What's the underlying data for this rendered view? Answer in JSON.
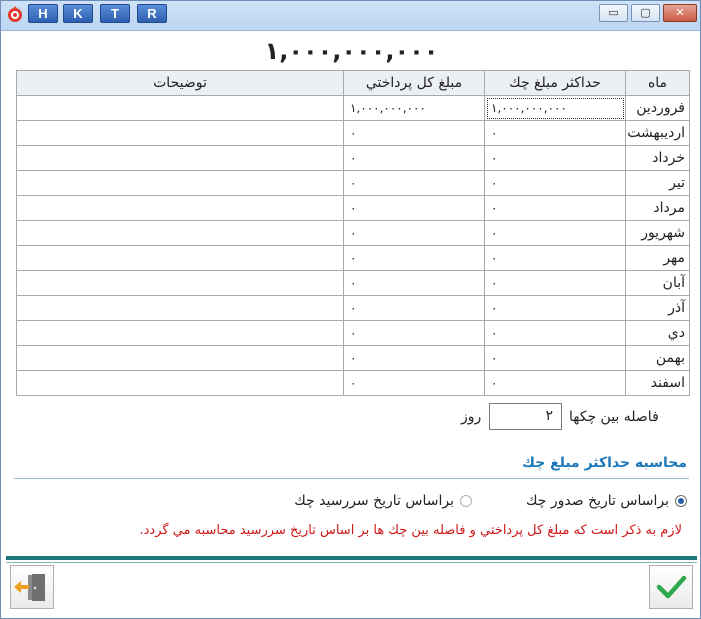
{
  "titlebar": {
    "hotkeys": [
      "H",
      "K",
      "T",
      "R"
    ],
    "minimize_label": "▭",
    "maximize_label": "▢",
    "close_label": "✕"
  },
  "total_amount": "۱,۰۰۰,۰۰۰,۰۰۰",
  "table": {
    "headers": {
      "month": "ماه",
      "max_check": "حداکثر مبلغ چك",
      "total_payment": "مبلغ کل پرداختي",
      "notes": "توضيحات"
    },
    "rows": [
      {
        "month": "فروردين",
        "max_check": "۱,۰۰۰,۰۰۰,۰۰۰",
        "total_payment": "۱,۰۰۰,۰۰۰,۰۰۰",
        "notes": ""
      },
      {
        "month": "ارديبهشت",
        "max_check": "۰",
        "total_payment": "۰",
        "notes": ""
      },
      {
        "month": "خرداد",
        "max_check": "۰",
        "total_payment": "۰",
        "notes": ""
      },
      {
        "month": "تير",
        "max_check": "۰",
        "total_payment": "۰",
        "notes": ""
      },
      {
        "month": "مرداد",
        "max_check": "۰",
        "total_payment": "۰",
        "notes": ""
      },
      {
        "month": "شهريور",
        "max_check": "۰",
        "total_payment": "۰",
        "notes": ""
      },
      {
        "month": "مهر",
        "max_check": "۰",
        "total_payment": "۰",
        "notes": ""
      },
      {
        "month": "آبان",
        "max_check": "۰",
        "total_payment": "۰",
        "notes": ""
      },
      {
        "month": "آذر",
        "max_check": "۰",
        "total_payment": "۰",
        "notes": ""
      },
      {
        "month": "دي",
        "max_check": "۰",
        "total_payment": "۰",
        "notes": ""
      },
      {
        "month": "بهمن",
        "max_check": "۰",
        "total_payment": "۰",
        "notes": ""
      },
      {
        "month": "اسفند",
        "max_check": "۰",
        "total_payment": "۰",
        "notes": ""
      }
    ]
  },
  "gap": {
    "label": "فاصله بين چکها",
    "value": "۲",
    "unit": "روز"
  },
  "calc": {
    "title": "محاسبه حداکثر مبلغ چك",
    "option_issue": "براساس تاريخ صدور چك",
    "option_due": "براساس تاريخ سررسيد چك",
    "selected": "issue"
  },
  "note": "لازم به ذکر است که مبلغ کل پرداختي و فاصله بين چك ها بر اساس تاريخ سررسيد محاسبه مي گردد.",
  "colors": {
    "accent": "#1c78b8",
    "warning": "#d01717",
    "footer_rule": "#1b7a79",
    "ok_check": "#2fa84f",
    "exit_arrow": "#f0a020"
  },
  "icons": {
    "exit": "exit-door-icon",
    "ok": "checkmark-icon"
  }
}
